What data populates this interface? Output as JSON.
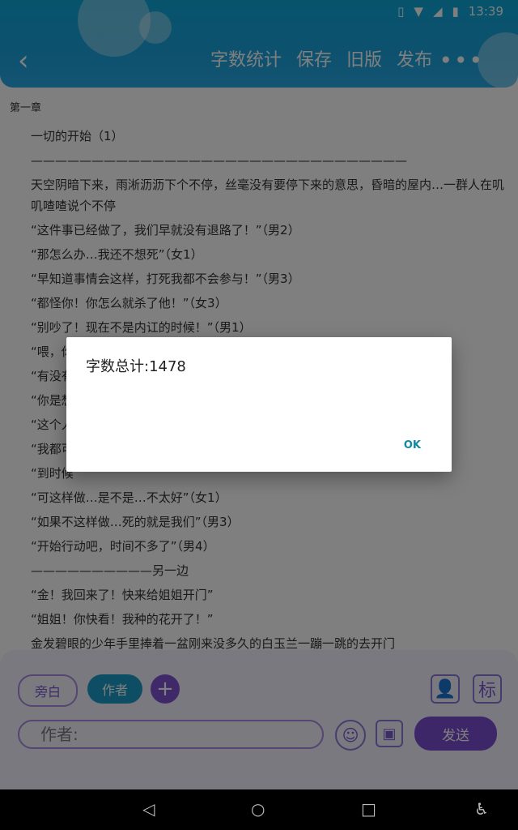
{
  "status": {
    "time": "13:39"
  },
  "header": {
    "back_icon": "back-chevron-icon",
    "actions": [
      "字数统计",
      "保存",
      "旧版",
      "发布"
    ],
    "more_icon": "more-dots-icon"
  },
  "content": {
    "chapter": "第一章",
    "paragraphs": [
      "一切的开始（1）",
      "———————————————————————————————",
      "天空阴暗下来，雨淅沥沥下个不停，丝毫没有要停下来的意思，昏暗的屋内…一群人在叽叽喳喳说个不停",
      "“这件事已经做了，我们早就没有退路了！”（男2）",
      "“那怎么办…我还不想死”（女1）",
      "“早知道事情会这样，打死我都不会参与！”（男3）",
      "“都怪你！你怎么就杀了他！”（女3）",
      "“别吵了！现在不是内讧的时候！”（男1）",
      "“喂，你",
      "“有没有",
      "“你是想",
      "“这个人",
      "“我都可",
      "“到时候",
      "“可这样做…是不是…不太好”（女1）",
      "“如果不这样做…死的就是我们”（男3）",
      "“开始行动吧，时间不多了”（男4）",
      "——————————另一边",
      "“金！我回来了！快来给姐姐开门”",
      "“姐姐！你快看！我种的花开了！”",
      "金发碧眼的少年手里捧着一盆刚来没多久的白玉兰一蹦一跳的去开门"
    ]
  },
  "composer": {
    "narration": "旁白",
    "author": "作者",
    "add_icon": "plus-icon",
    "person_icon": "person-icon",
    "tag_label": "标",
    "input_placeholder": "作者:",
    "emoji_icon": "emoji-icon",
    "image_icon": "image-icon",
    "send": "发送"
  },
  "dialog": {
    "title": "字数总计:1478",
    "ok": "OK"
  },
  "navbar": {
    "back_icon": "nav-back-icon",
    "home_icon": "nav-home-icon",
    "recents_icon": "nav-recents-icon",
    "accessibility_icon": "accessibility-icon"
  }
}
